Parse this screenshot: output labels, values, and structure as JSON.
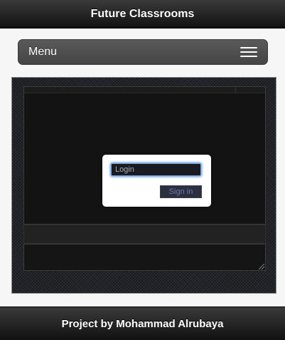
{
  "header": {
    "title": "Future Classrooms"
  },
  "menu": {
    "label": "Menu",
    "icon": "hamburger-icon"
  },
  "login": {
    "placeholder": "Login",
    "value": "",
    "button_label": "Sign in"
  },
  "footer": {
    "text": "Project by Mohammad Alrubaya"
  },
  "colors": {
    "header_bg": "#111111",
    "menu_bg": "#4d4d4d",
    "input_focus": "#4f8fd8",
    "button_text": "#6e7ab2"
  }
}
